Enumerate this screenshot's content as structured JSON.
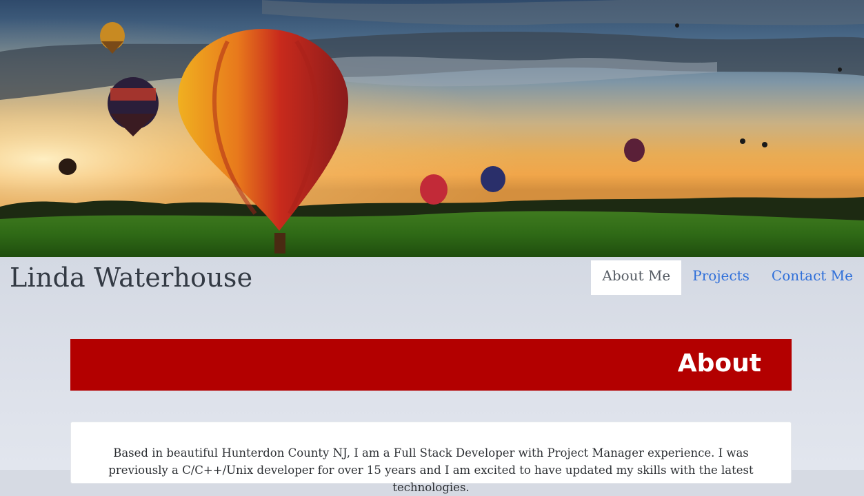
{
  "header": {
    "site_title": "Linda Waterhouse"
  },
  "nav": {
    "items": [
      {
        "label": "About Me",
        "active": true
      },
      {
        "label": "Projects",
        "active": false
      },
      {
        "label": "Contact Me",
        "active": false
      }
    ]
  },
  "about": {
    "heading": "About",
    "paragraph": "Based in beautiful Hunterdon County NJ, I am a Full Stack Developer with Project Manager experience. I was previously a C/C++/Unix developer for over 15 years and I am excited to have updated my skills with the latest technologies."
  },
  "colors": {
    "banner": "#b30000",
    "link": "#2f6fd9"
  }
}
